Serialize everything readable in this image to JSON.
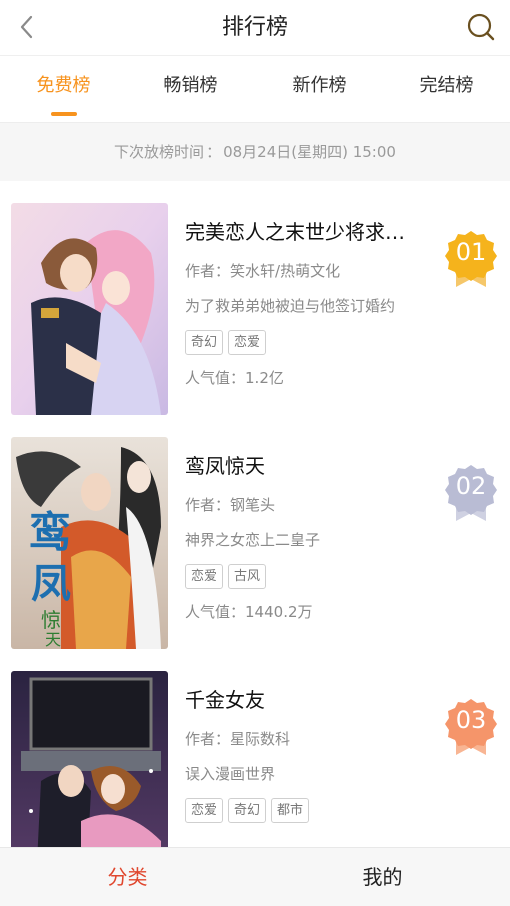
{
  "header": {
    "title": "排行榜",
    "back_icon": "chevron-left-icon",
    "search_icon": "search-icon"
  },
  "tabs": [
    {
      "label": "免费榜",
      "active": true
    },
    {
      "label": "畅销榜",
      "active": false
    },
    {
      "label": "新作榜",
      "active": false
    },
    {
      "label": "完结榜",
      "active": false
    }
  ],
  "next_update": {
    "label": "下次放榜时间",
    "value": "08月24日(星期四) 15:00"
  },
  "items": [
    {
      "rank": "01",
      "title": "完美恋人之末世少将求婚记",
      "author_label": "作者：",
      "author": "笑水轩/热萌文化",
      "desc": "为了救弟弟她被迫与他签订婚约",
      "tags": [
        "奇幻",
        "恋爱"
      ],
      "popularity_label": "人气值：",
      "popularity": "1.2亿",
      "badge_color": "#f5b31c"
    },
    {
      "rank": "02",
      "title": "鸾凤惊天",
      "author_label": "作者：",
      "author": "钢笔头",
      "desc": "神界之女恋上二皇子",
      "tags": [
        "恋爱",
        "古风"
      ],
      "popularity_label": "人气值：",
      "popularity": "1440.2万",
      "badge_color": "#b9bcd4"
    },
    {
      "rank": "03",
      "title": "千金女友",
      "author_label": "作者：",
      "author": "星际数科",
      "desc": "误入漫画世界",
      "tags": [
        "恋爱",
        "奇幻",
        "都市"
      ],
      "badge_color": "#f5956a"
    }
  ],
  "bottom_nav": [
    {
      "label": "分类",
      "active": true
    },
    {
      "label": "我的",
      "active": false
    }
  ],
  "colors": {
    "accent": "#f7931e",
    "bottom_active": "#e0472e"
  }
}
